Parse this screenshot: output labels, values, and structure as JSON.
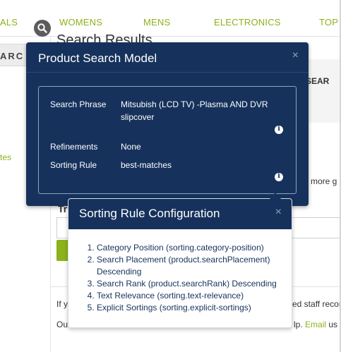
{
  "nav": {
    "items": [
      "ALS",
      "WOMENS",
      "MENS",
      "ELECTRONICS",
      "TOP S"
    ]
  },
  "background": {
    "search_label": "ARC",
    "left_link": "tes",
    "results_title": "Search Results",
    "right_panel_text": "R SEAR",
    "more_text": "a more g",
    "try_label": "Tr",
    "line1_left": "If y",
    "line1_right": "ed staff recom",
    "line2_left": "Ou",
    "line2_right_prefix": "lp. ",
    "line2_right_link": "Email",
    "line2_right_suffix": " us c"
  },
  "product_search_modal": {
    "title": "Product Search Model",
    "close_label": "×",
    "rows": [
      {
        "label": "Search Phrase",
        "value": "Mitsubish (LCD TV) -Plasma AND DVR slipcover"
      },
      {
        "label": "Refinements",
        "value": "None"
      },
      {
        "label": "Sorting Rule",
        "value": "best-matches"
      }
    ],
    "info_glyph": "i"
  },
  "sorting_rule_modal": {
    "title": "Sorting Rule Configuration",
    "close_label": "×",
    "rules": [
      "Category Position (sorting.category-position)",
      "Search Placement (product.searchPlacement) Descending",
      "Search Rank (product.searchRank) Descending",
      "Text Relevance (sorting.text-relevance)",
      "Explicit Sortings (sorting.explicit-sortings)"
    ]
  },
  "icons": {
    "search": "search-icon",
    "info": "info-icon",
    "close": "close-icon"
  },
  "colors": {
    "brand_green": "#8cb21c",
    "modal_navy": "#16325c",
    "modal_border": "#8fa3c2"
  }
}
